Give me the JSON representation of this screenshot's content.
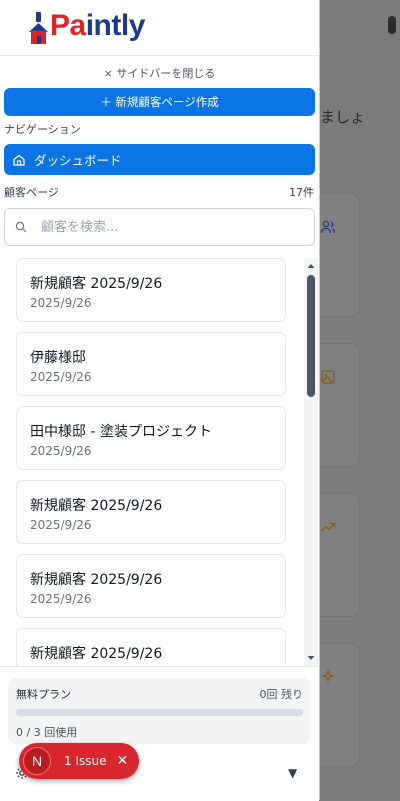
{
  "app": {
    "logo_text_1": "Pa",
    "logo_text_2": "int",
    "logo_text_3": "ly",
    "colors": {
      "primary": "#0b74e5",
      "logo_red": "#dc2626",
      "logo_navy": "#1e3a8a"
    }
  },
  "sidebar": {
    "close_label": "× サイドバーを閉じる",
    "new_page_button": "＋ 新規顧客ページ作成",
    "nav_heading": "ナビゲーション",
    "dashboard_label": "ダッシュボード",
    "customers_heading": "顧客ページ",
    "customers_count": "17件",
    "search_placeholder": "顧客を検索...",
    "customers": [
      {
        "title": "新規顧客 2025/9/26",
        "date": "2025/9/26"
      },
      {
        "title": "伊藤様邸",
        "date": "2025/9/26"
      },
      {
        "title": "田中様邸 - 塗装プロジェクト",
        "date": "2025/9/26"
      },
      {
        "title": "新規顧客 2025/9/26",
        "date": "2025/9/26"
      },
      {
        "title": "新規顧客 2025/9/26",
        "date": "2025/9/26"
      },
      {
        "title": "新規顧客 2025/9/26",
        "date": ""
      }
    ]
  },
  "plan": {
    "name": "無料プラン",
    "remaining": "0回 残り",
    "usage": "0 / 3 回使用",
    "usage_fraction": 0
  },
  "background": {
    "visible_text": "ましょ"
  },
  "issue_badge": {
    "avatar_letter": "N",
    "label": "1 Issue",
    "close": "✕"
  }
}
